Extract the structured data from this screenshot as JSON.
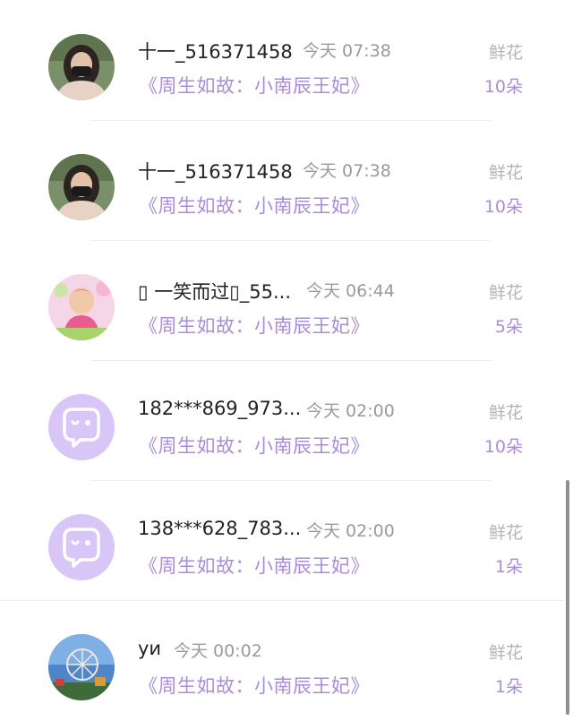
{
  "items": [
    {
      "avatar": "masked-girl-avatar",
      "name": "十一_516371458",
      "time": "今天 07:38",
      "book": "《周生如故：小南辰王妃》",
      "gift_type": "鲜花",
      "gift_count": "10朵"
    },
    {
      "avatar": "masked-girl-avatar",
      "name": "十一_516371458",
      "time": "今天 07:38",
      "book": "《周生如故：小南辰王妃》",
      "gift_type": "鲜花",
      "gift_count": "10朵"
    },
    {
      "avatar": "baby-photo-avatar",
      "name": "▯ 一笑而过▯_55...",
      "time": "今天 06:44",
      "book": "《周生如故：小南辰王妃》",
      "gift_type": "鲜花",
      "gift_count": "5朵"
    },
    {
      "avatar": "default-chat-avatar",
      "name": "182***869_973...",
      "time": "今天 02:00",
      "book": "《周生如故：小南辰王妃》",
      "gift_type": "鲜花",
      "gift_count": "10朵"
    },
    {
      "avatar": "default-chat-avatar",
      "name": "138***628_783...",
      "time": "今天 02:00",
      "book": "《周生如故：小南辰王妃》",
      "gift_type": "鲜花",
      "gift_count": "1朵"
    },
    {
      "avatar": "ferris-wheel-avatar",
      "name": "yи",
      "time": "今天 00:02",
      "book": "《周生如故：小南辰王妃》",
      "gift_type": "鲜花",
      "gift_count": "1朵"
    }
  ],
  "colors": {
    "accent": "#a98dd6",
    "default_avatar_bg": "#d8c6f7",
    "text_primary": "#222222",
    "text_secondary": "#9a9a9a"
  }
}
